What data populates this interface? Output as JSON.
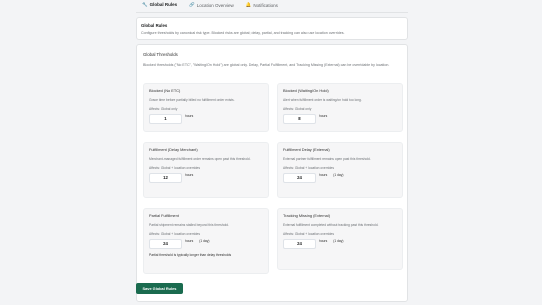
{
  "tabs": [
    {
      "label": "Global Rules",
      "icon": "wrench-icon",
      "glyph": "🔧"
    },
    {
      "label": "Location Overview",
      "icon": "link-icon",
      "glyph": "🔗"
    },
    {
      "label": "Notifications",
      "icon": "bell-icon",
      "glyph": "🔔"
    }
  ],
  "header": {
    "title": "Global Rules",
    "description": "Configure thresholds by canonical risk type. Blocked risks are global; delay, partial, and tracking can also use location overrides."
  },
  "thresholds": {
    "title": "Global Thresholds",
    "description": "Blocked thresholds (\"No ETC\", \"Waiting/On Hold\") are global only. Delay, Partial Fulfillment, and Tracking Missing (External) can be overridable by location."
  },
  "rules": [
    {
      "title": "Blocked (No ETC)",
      "desc": "Grace time before partially billed no fulfillment order exists.",
      "affects": "Affects: Global only",
      "value": "1",
      "unit": "hours",
      "note": "",
      "footnote": ""
    },
    {
      "title": "Blocked (Waiting/On Hold)",
      "desc": "Alert when fulfillment order is waiting/on hold too long.",
      "affects": "Affects: Global only",
      "value": "8",
      "unit": "hours",
      "note": "",
      "footnote": ""
    },
    {
      "title": "Fulfillment (Delay Merchant)",
      "desc": "Merchant-managed fulfillment order remains open past this threshold.",
      "affects": "Affects: Global + location overrides",
      "value": "12",
      "unit": "hours",
      "note": "",
      "footnote": ""
    },
    {
      "title": "Fulfillment Delay (External)",
      "desc": "External partner fulfillment remains open past this threshold.",
      "affects": "Affects: Global + location overrides",
      "value": "24",
      "unit": "hours",
      "note": "(1 day)",
      "footnote": ""
    },
    {
      "title": "Partial Fulfillment",
      "desc": "Partial shipment remains stalled beyond this threshold.",
      "affects": "Affects: Global + location overrides",
      "value": "24",
      "unit": "hours",
      "note": "(1 day)",
      "footnote": "Partial threshold is typically longer than delay thresholds"
    },
    {
      "title": "Tracking Missing (External)",
      "desc": "External fulfillment completed without tracking past this threshold.",
      "affects": "Affects: Global + location overrides",
      "value": "24",
      "unit": "hours",
      "note": "(1 day)",
      "footnote": ""
    }
  ],
  "save_label": "Save Global Rules"
}
